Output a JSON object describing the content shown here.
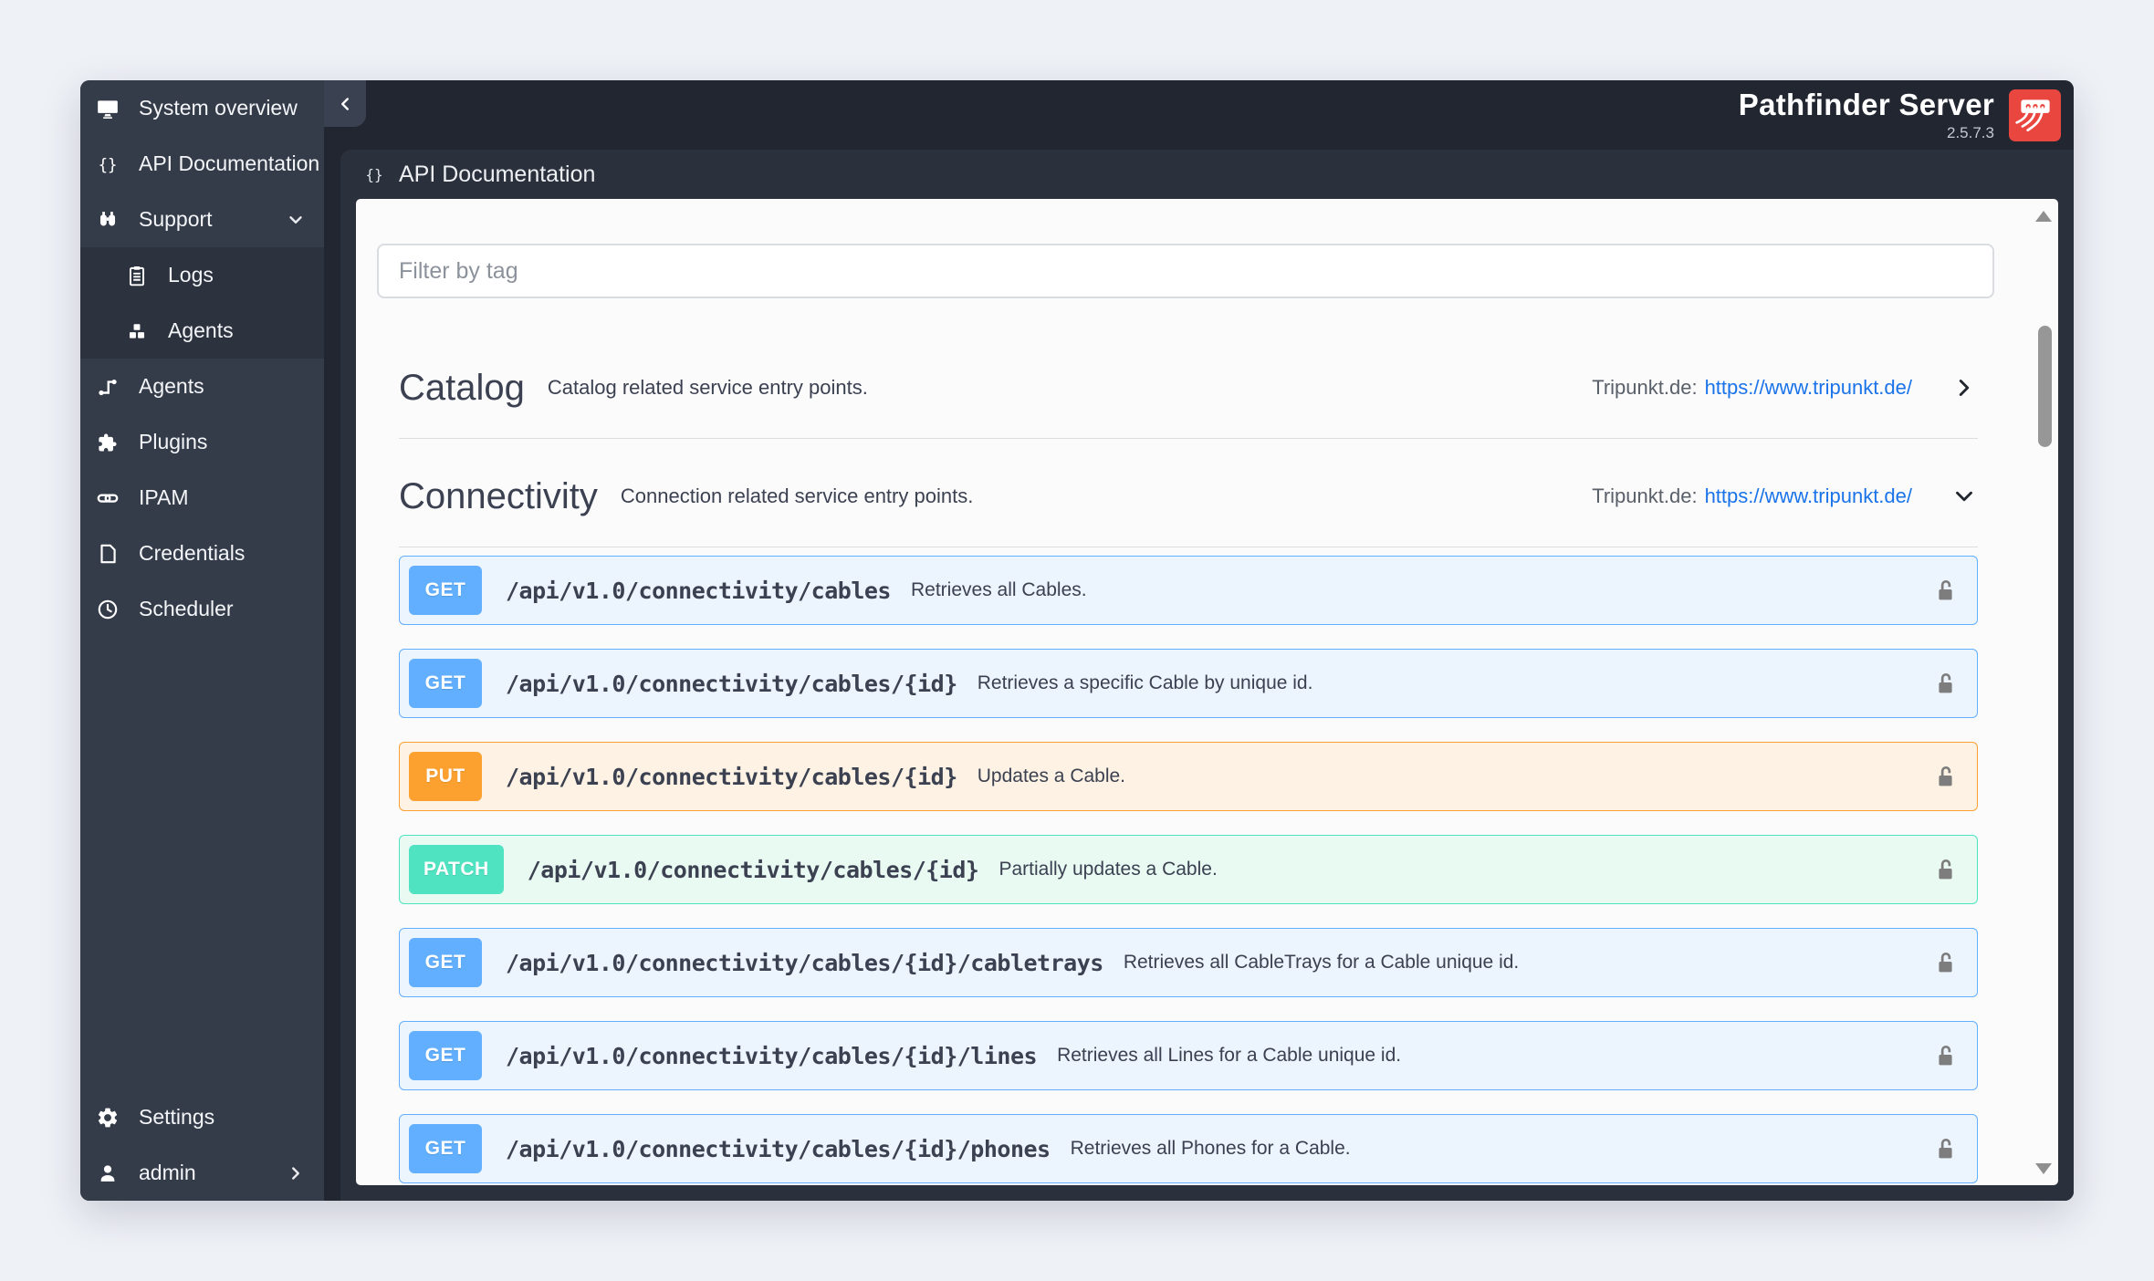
{
  "brand": {
    "title": "Pathfinder Server",
    "version": "2.5.7.3"
  },
  "page": {
    "title": "API Documentation"
  },
  "filter": {
    "placeholder": "Filter by tag"
  },
  "sidebar": {
    "items": [
      {
        "label": "System overview",
        "icon": "monitor",
        "type": "item"
      },
      {
        "label": "API Documentation",
        "icon": "braces",
        "type": "item"
      },
      {
        "label": "Support",
        "icon": "binoculars",
        "type": "item",
        "chevron": "down"
      },
      {
        "label": "Logs",
        "icon": "clipboard",
        "type": "subitem"
      },
      {
        "label": "Agents",
        "icon": "boxes",
        "type": "subitem"
      },
      {
        "label": "Agents",
        "icon": "route",
        "type": "item"
      },
      {
        "label": "Plugins",
        "icon": "puzzle",
        "type": "item"
      },
      {
        "label": "IPAM",
        "icon": "link",
        "type": "item"
      },
      {
        "label": "Credentials",
        "icon": "card",
        "type": "item"
      },
      {
        "label": "Scheduler",
        "icon": "clock",
        "type": "item"
      }
    ],
    "bottom_items": [
      {
        "label": "Settings",
        "icon": "gear",
        "type": "item"
      },
      {
        "label": "admin",
        "icon": "person",
        "type": "item",
        "chevron": "right"
      }
    ]
  },
  "sections": [
    {
      "title": "Catalog",
      "description": "Catalog related service entry points.",
      "link_label": "Tripunkt.de:",
      "link_url": "https://www.tripunkt.de/",
      "state": "collapsed",
      "endpoints": []
    },
    {
      "title": "Connectivity",
      "description": "Connection related service entry points.",
      "link_label": "Tripunkt.de:",
      "link_url": "https://www.tripunkt.de/",
      "state": "expanded",
      "endpoints": [
        {
          "method": "GET",
          "path": "/api/v1.0/connectivity/cables",
          "description": "Retrieves all Cables."
        },
        {
          "method": "GET",
          "path": "/api/v1.0/connectivity/cables/{id}",
          "description": "Retrieves a specific Cable by unique id."
        },
        {
          "method": "PUT",
          "path": "/api/v1.0/connectivity/cables/{id}",
          "description": "Updates a Cable."
        },
        {
          "method": "PATCH",
          "path": "/api/v1.0/connectivity/cables/{id}",
          "description": "Partially updates a Cable."
        },
        {
          "method": "GET",
          "path": "/api/v1.0/connectivity/cables/{id}/cabletrays",
          "description": "Retrieves all CableTrays for a Cable unique id."
        },
        {
          "method": "GET",
          "path": "/api/v1.0/connectivity/cables/{id}/lines",
          "description": "Retrieves all Lines for a Cable unique id."
        },
        {
          "method": "GET",
          "path": "/api/v1.0/connectivity/cables/{id}/phones",
          "description": "Retrieves all Phones for a Cable."
        }
      ]
    }
  ],
  "colors": {
    "get": "#61affe",
    "put": "#fca130",
    "patch": "#50e3c2",
    "link": "#1a73e8",
    "brand_red": "#e8463f"
  }
}
